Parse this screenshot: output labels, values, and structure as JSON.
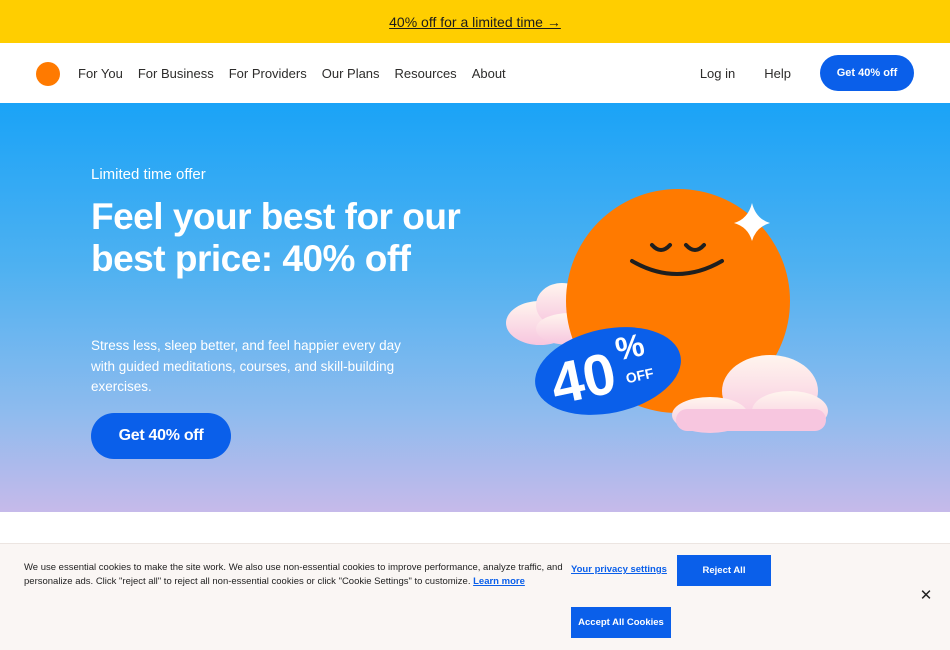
{
  "promo": {
    "text": "40% off for a limited time →"
  },
  "nav": {
    "links": [
      "For You",
      "For Business",
      "For Providers",
      "Our Plans",
      "Resources",
      "About"
    ],
    "login": "Log in",
    "help": "Help",
    "cta": "Get 40% off"
  },
  "hero": {
    "eyebrow": "Limited time offer",
    "title": "Feel your best for our best price: 40% off",
    "subtitle": "Stress less, sleep better, and feel happier every day with guided meditations, courses, and skill-building exercises.",
    "cta": "Get 40% off",
    "badge_value": "40",
    "badge_percent": "%",
    "badge_off": "OFF"
  },
  "cookie": {
    "text": "We use essential cookies to make the site work. We also use non-essential cookies to improve performance, analyze traffic, and personalize ads. Click \"reject all\" to reject all non-essential cookies or click \"Cookie Settings\" to customize.",
    "learn_more": "Learn more",
    "privacy_settings": "Your privacy settings",
    "reject": "Reject All",
    "accept": "Accept All Cookies",
    "close": "✕"
  },
  "colors": {
    "promo_bg": "#ffce00",
    "brand_orange": "#ff7a00",
    "primary_blue": "#0a5fea"
  }
}
